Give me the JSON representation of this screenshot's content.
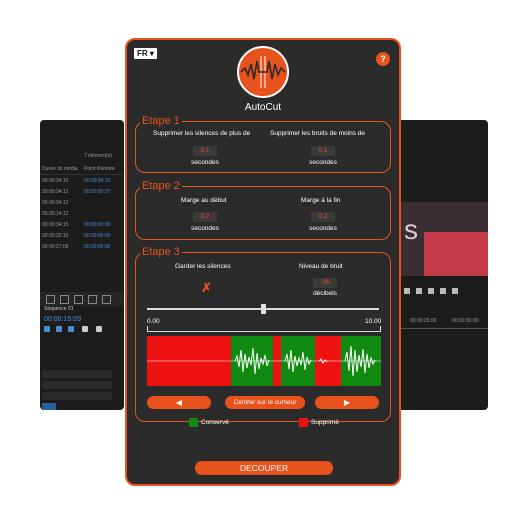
{
  "colors": {
    "accent": "#e8521d",
    "panel_bg": "#2b2b2b",
    "kept": "#108a10",
    "removed": "#ee1111"
  },
  "bg_left": {
    "count_label": "7 élément(s)",
    "col1": "Durée du média",
    "col2": "Point d'entrée",
    "rows": [
      [
        "00:00:34:10",
        "00:00:34:10"
      ],
      [
        "00:00:34:12",
        "00:00:00:07"
      ],
      [
        "00:00:34:12",
        ""
      ],
      [
        "00:00:14:12",
        ""
      ],
      [
        "00:00:34:15",
        "00:00:00:00"
      ],
      [
        "00:00:30:10",
        "00:00:00:00"
      ],
      [
        "00:00:27:09",
        "00:00:00:00"
      ]
    ],
    "sequence_label": "Séquence 01",
    "timecode": "00:00:15:09"
  },
  "bg_right": {
    "times": [
      "00:00:25:00",
      "00:00:30:00"
    ]
  },
  "header": {
    "lang": "FR ▾",
    "help": "?",
    "app_name": "AutoCut",
    "logo_icon": "waveform-logo-icon"
  },
  "step1": {
    "title": "Etape 1",
    "silence_label": "Supprimer les silences de plus de",
    "silence_value": "0,1",
    "silence_unit": "secondes",
    "noise_label": "Supprimer les bruits de moins de",
    "noise_value": "0,1",
    "noise_unit": "secondes"
  },
  "step2": {
    "title": "Etape 2",
    "start_label": "Marge au début",
    "start_value": "0,2",
    "start_unit": "secondes",
    "end_label": "Marge à la fin",
    "end_value": "0,2",
    "end_unit": "secondes"
  },
  "step3": {
    "title": "Etape 3",
    "keep_label": "Garder les silences",
    "keep_icon": "✗",
    "noise_label": "Niveau de bruit",
    "noise_value": "-35",
    "noise_unit": "décibels",
    "slider_level": 0.5,
    "time_start": "0.00",
    "time_end": "10.00",
    "prev_icon": "◀",
    "center_label": "Centrer sur le curseur",
    "next_icon": "▶",
    "legend_kept": "Conservé",
    "legend_removed": "Supprimé"
  },
  "cut_label": "DECOUPER"
}
